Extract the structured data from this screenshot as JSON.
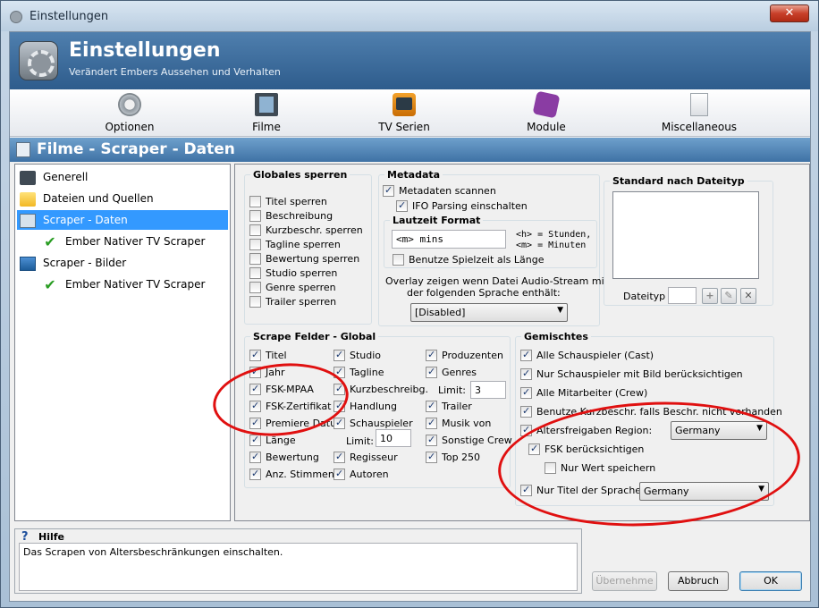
{
  "window": {
    "title": "Einstellungen",
    "close_glyph": "✕"
  },
  "header": {
    "title": "Einstellungen",
    "subtitle": "Verändert Embers Aussehen und Verhalten"
  },
  "toolbar": {
    "items": [
      {
        "label": "Optionen",
        "icon": "gear-icon"
      },
      {
        "label": "Filme",
        "icon": "film-icon"
      },
      {
        "label": "TV Serien",
        "icon": "tv-icon"
      },
      {
        "label": "Module",
        "icon": "puzzle-icon"
      },
      {
        "label": "Miscellaneous",
        "icon": "document-icon"
      }
    ]
  },
  "section": {
    "title": "Filme - Scraper - Daten"
  },
  "tree": {
    "items": [
      {
        "label": "Generell",
        "icon": "film-icon"
      },
      {
        "label": "Dateien und Quellen",
        "icon": "folder-icon"
      },
      {
        "label": "Scraper - Daten",
        "icon": "data-icon",
        "selected": true
      },
      {
        "label": "Ember Nativer TV Scraper",
        "icon": "check-icon"
      },
      {
        "label": "Scraper - Bilder",
        "icon": "image-icon"
      },
      {
        "label": "Ember Nativer TV Scraper",
        "icon": "check-icon"
      }
    ]
  },
  "globales_sperren": {
    "legend": "Globales sperren",
    "items": [
      {
        "label": "Titel sperren",
        "checked": false
      },
      {
        "label": "Beschreibung",
        "checked": false
      },
      {
        "label": "Kurzbeschr. sperren",
        "checked": false
      },
      {
        "label": "Tagline sperren",
        "checked": false
      },
      {
        "label": "Bewertung sperren",
        "checked": false
      },
      {
        "label": "Studio sperren",
        "checked": false
      },
      {
        "label": "Genre sperren",
        "checked": false
      },
      {
        "label": "Trailer sperren",
        "checked": false
      }
    ]
  },
  "metadata": {
    "legend": "Metadata",
    "scan": {
      "label": "Metadaten scannen",
      "checked": true
    },
    "ifo": {
      "label": "IFO Parsing einschalten",
      "checked": true
    },
    "laufzeit": {
      "legend": "Lautzeit Format",
      "value": "<m> mins",
      "hint1": "<h> = Stunden,",
      "hint2": "<m> = Minuten",
      "spielzeit": {
        "label": "Benutze Spielzeit als Länge",
        "checked": false
      }
    },
    "overlay_text1": "Overlay zeigen wenn Datei Audio-Stream mit",
    "overlay_text2": "der folgenden Sprache enthält:",
    "overlay_value": "[Disabled]"
  },
  "standard": {
    "legend": "Standard nach Dateityp",
    "dateityp_label": "Dateityp",
    "dateityp_value": "",
    "add": "+",
    "edit": "✎",
    "remove": "✕"
  },
  "scrape_felder": {
    "legend": "Scrape Felder - Global",
    "col1": [
      {
        "label": "Titel",
        "checked": true
      },
      {
        "label": "Jahr",
        "checked": true
      },
      {
        "label": "FSK-MPAA",
        "checked": true
      },
      {
        "label": "FSK-Zertifikat",
        "checked": true
      },
      {
        "label": "Premiere Datum",
        "checked": true
      },
      {
        "label": "Länge",
        "checked": true
      },
      {
        "label": "Bewertung",
        "checked": true
      },
      {
        "label": "Anz. Stimmen",
        "checked": true
      }
    ],
    "col2": [
      {
        "label": "Studio",
        "checked": true
      },
      {
        "label": "Tagline",
        "checked": true
      },
      {
        "label": "Kurzbeschreibg.",
        "checked": true
      },
      {
        "label": "Handlung",
        "checked": true
      },
      {
        "label": "Schauspieler",
        "checked": true
      },
      {
        "label": "Regisseur",
        "checked": true
      },
      {
        "label": "Autoren",
        "checked": true
      }
    ],
    "col3": [
      {
        "label": "Produzenten",
        "checked": true
      },
      {
        "label": "Genres",
        "checked": true
      },
      {
        "label": "Trailer",
        "checked": true
      },
      {
        "label": "Musik von",
        "checked": true
      },
      {
        "label": "Sonstige Crew",
        "checked": true
      },
      {
        "label": "Top 250",
        "checked": true
      }
    ],
    "limit_label": "Limit:",
    "limit1": "3",
    "limit2": "10"
  },
  "gemischtes": {
    "legend": "Gemischtes",
    "items": [
      {
        "label": "Alle Schauspieler (Cast)",
        "checked": true
      },
      {
        "label": "Nur Schauspieler mit Bild berücksichtigen",
        "checked": true
      },
      {
        "label": "Alle Mitarbeiter (Crew)",
        "checked": true
      },
      {
        "label": "Benutze Kurzbeschr. falls Beschr. nicht vorhanden",
        "checked": true
      }
    ],
    "alters": {
      "label": "Altersfreigaben Region:",
      "checked": true,
      "value": "Germany"
    },
    "fsk": {
      "label": "FSK berücksichtigen",
      "checked": true
    },
    "nurwert": {
      "label": "Nur Wert speichern",
      "checked": false
    },
    "nurtitel": {
      "label": "Nur Titel der Sprache:",
      "checked": true,
      "value": "Germany"
    }
  },
  "help": {
    "icon": "?",
    "title": "Hilfe",
    "text": "Das Scrapen von Altersbeschränkungen einschalten."
  },
  "buttons": {
    "apply": "Übernehme",
    "cancel": "Abbruch",
    "ok": "OK"
  },
  "annotation_color": "#e01010"
}
